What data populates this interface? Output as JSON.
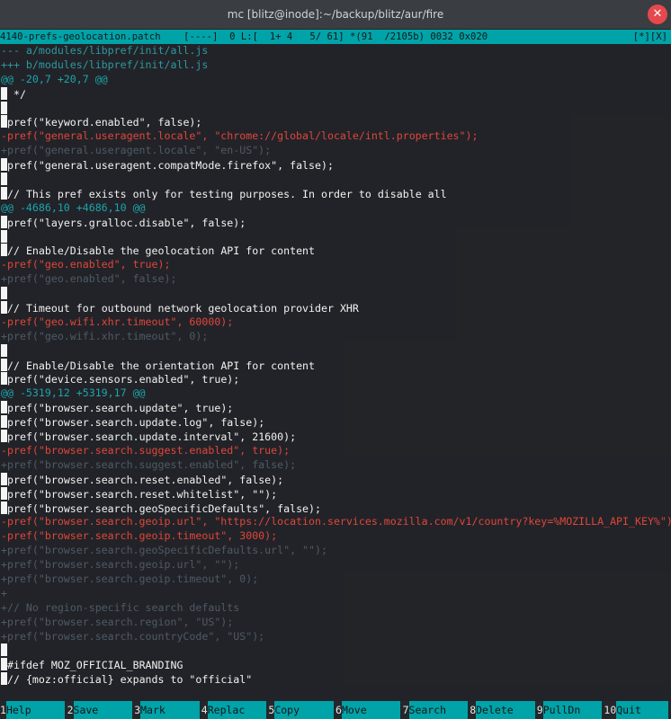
{
  "window": {
    "title": "mc [blitz@inode]:~/backup/blitz/aur/fire",
    "close_glyph": "✕"
  },
  "status": {
    "left": "4140-prefs-geolocation.patch    [----]  0 L:[  1+ 4   5/ 61] *(91  /2105b) 0032 0x020",
    "right": "[*][X]"
  },
  "lines": [
    {
      "text": "--- a/modules/libpref/init/all.js",
      "kind": "meta",
      "cursor": false
    },
    {
      "text": "+++ b/modules/libpref/init/all.js",
      "kind": "meta",
      "cursor": false
    },
    {
      "text": "@@ -20,7 +20,7 @@",
      "kind": "hunk",
      "cursor": false
    },
    {
      "text": " */",
      "kind": "ctx",
      "cursor": true
    },
    {
      "text": "",
      "kind": "ctx",
      "cursor": true
    },
    {
      "text": "pref(\"keyword.enabled\", false);",
      "kind": "ctx",
      "cursor": true
    },
    {
      "text": "-pref(\"general.useragent.locale\", \"chrome://global/locale/intl.properties\");",
      "kind": "del",
      "cursor": false
    },
    {
      "text": "+pref(\"general.useragent.locale\", \"en-US\");",
      "kind": "add",
      "cursor": false
    },
    {
      "text": "pref(\"general.useragent.compatMode.firefox\", false);",
      "kind": "ctx",
      "cursor": true
    },
    {
      "text": "",
      "kind": "ctx",
      "cursor": true
    },
    {
      "text": "// This pref exists only for testing purposes. In order to disable all",
      "kind": "ctx",
      "cursor": true
    },
    {
      "text": "@@ -4686,10 +4686,10 @@",
      "kind": "hunk",
      "cursor": false
    },
    {
      "text": "pref(\"layers.gralloc.disable\", false);",
      "kind": "ctx",
      "cursor": true
    },
    {
      "text": "",
      "kind": "ctx",
      "cursor": true
    },
    {
      "text": "// Enable/Disable the geolocation API for content",
      "kind": "ctx",
      "cursor": true
    },
    {
      "text": "-pref(\"geo.enabled\", true);",
      "kind": "del",
      "cursor": false
    },
    {
      "text": "+pref(\"geo.enabled\", false);",
      "kind": "add",
      "cursor": false
    },
    {
      "text": "",
      "kind": "ctx",
      "cursor": true
    },
    {
      "text": "// Timeout for outbound network geolocation provider XHR",
      "kind": "ctx",
      "cursor": true
    },
    {
      "text": "-pref(\"geo.wifi.xhr.timeout\", 60000);",
      "kind": "del",
      "cursor": false
    },
    {
      "text": "+pref(\"geo.wifi.xhr.timeout\", 0);",
      "kind": "add",
      "cursor": false
    },
    {
      "text": "",
      "kind": "ctx",
      "cursor": true
    },
    {
      "text": "// Enable/Disable the orientation API for content",
      "kind": "ctx",
      "cursor": true
    },
    {
      "text": "pref(\"device.sensors.enabled\", true);",
      "kind": "ctx",
      "cursor": true
    },
    {
      "text": "@@ -5319,12 +5319,17 @@",
      "kind": "hunk",
      "cursor": false
    },
    {
      "text": "pref(\"browser.search.update\", true);",
      "kind": "ctx",
      "cursor": true
    },
    {
      "text": "pref(\"browser.search.update.log\", false);",
      "kind": "ctx",
      "cursor": true
    },
    {
      "text": "pref(\"browser.search.update.interval\", 21600);",
      "kind": "ctx",
      "cursor": true
    },
    {
      "text": "-pref(\"browser.search.suggest.enabled\", true);",
      "kind": "del",
      "cursor": false
    },
    {
      "text": "+pref(\"browser.search.suggest.enabled\", false);",
      "kind": "add",
      "cursor": false
    },
    {
      "text": "pref(\"browser.search.reset.enabled\", false);",
      "kind": "ctx",
      "cursor": true
    },
    {
      "text": "pref(\"browser.search.reset.whitelist\", \"\");",
      "kind": "ctx",
      "cursor": true
    },
    {
      "text": "pref(\"browser.search.geoSpecificDefaults\", false);",
      "kind": "ctx",
      "cursor": true
    },
    {
      "text": "-pref(\"browser.search.geoip.url\", \"https://location.services.mozilla.com/v1/country?key=%MOZILLA_API_KEY%\");",
      "kind": "del",
      "cursor": false
    },
    {
      "text": "-pref(\"browser.search.geoip.timeout\", 3000);",
      "kind": "del",
      "cursor": false
    },
    {
      "text": "+pref(\"browser.search.geoSpecificDefaults.url\", \"\");",
      "kind": "add",
      "cursor": false
    },
    {
      "text": "+pref(\"browser.search.geoip.url\", \"\");",
      "kind": "add",
      "cursor": false
    },
    {
      "text": "+pref(\"browser.search.geoip.timeout\", 0);",
      "kind": "add",
      "cursor": false
    },
    {
      "text": "+",
      "kind": "add",
      "cursor": false
    },
    {
      "text": "+// No region-specific search defaults",
      "kind": "add",
      "cursor": false
    },
    {
      "text": "+pref(\"browser.search.region\", \"US\");",
      "kind": "add",
      "cursor": false
    },
    {
      "text": "+pref(\"browser.search.countryCode\", \"US\");",
      "kind": "add",
      "cursor": false
    },
    {
      "text": "",
      "kind": "ctx",
      "cursor": true
    },
    {
      "text": "#ifdef MOZ_OFFICIAL_BRANDING",
      "kind": "ctx",
      "cursor": true
    },
    {
      "text": "// {moz:official} expands to \"official\"",
      "kind": "ctx",
      "cursor": true
    }
  ],
  "fkeys": [
    {
      "num": "1",
      "label": "Help"
    },
    {
      "num": "2",
      "label": "Save"
    },
    {
      "num": "3",
      "label": "Mark"
    },
    {
      "num": "4",
      "label": "Replac"
    },
    {
      "num": "5",
      "label": "Copy"
    },
    {
      "num": "6",
      "label": "Move"
    },
    {
      "num": "7",
      "label": "Search"
    },
    {
      "num": "8",
      "label": "Delete"
    },
    {
      "num": "9",
      "label": "PullDn"
    },
    {
      "num": "10",
      "label": "Quit"
    }
  ],
  "colors": {
    "accent": "#00a3a8",
    "deleted": "#e0463a",
    "added": "#4e5a66",
    "hunk": "#1aa6ad",
    "close": "#e5484d"
  }
}
